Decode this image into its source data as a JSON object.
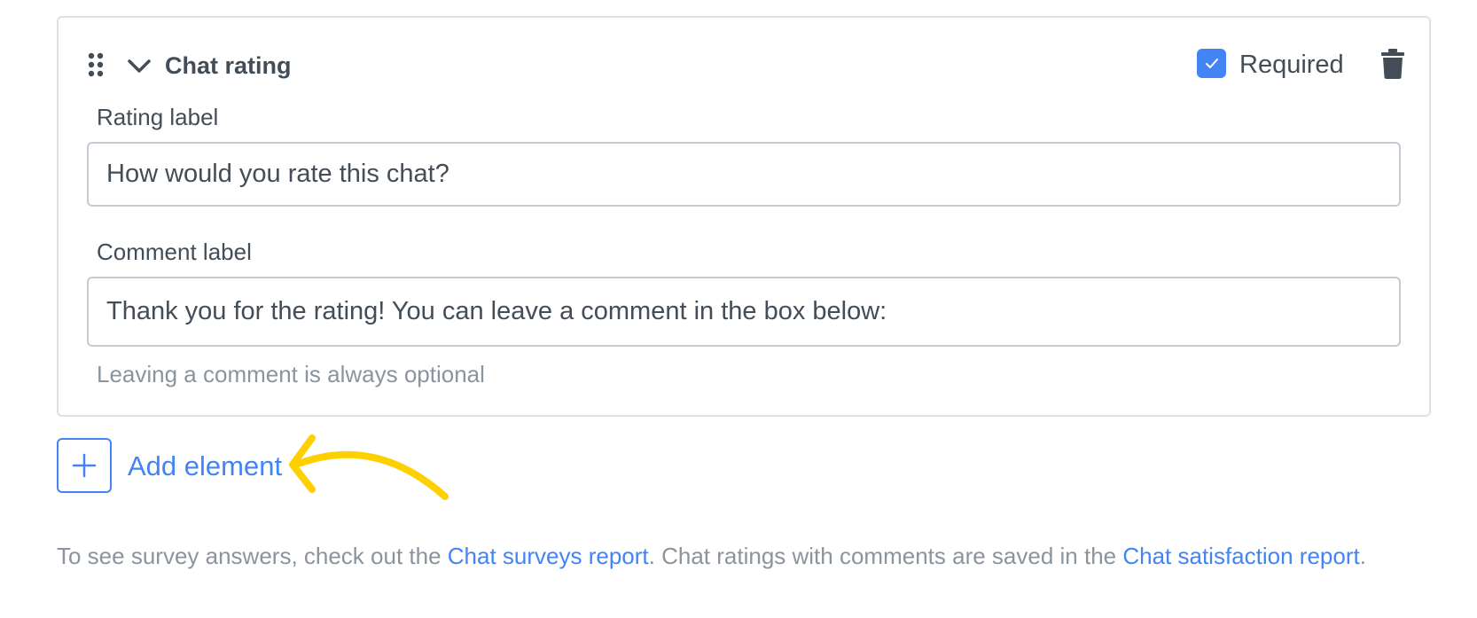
{
  "card": {
    "title": "Chat rating",
    "required_label": "Required",
    "required_checked": true,
    "rating_field": {
      "label": "Rating label",
      "value": "How would you rate this chat?"
    },
    "comment_field": {
      "label": "Comment label",
      "value": "Thank you for the rating! You can leave a comment in the box below:",
      "hint": "Leaving a comment is always optional"
    }
  },
  "add_element": {
    "label": "Add element",
    "icon": "plus-icon"
  },
  "footer": {
    "text_1": "To see survey answers, check out the ",
    "link_1": "Chat surveys report",
    "text_2": ". Chat ratings with comments are saved in the ",
    "link_2": "Chat satisfaction report",
    "text_3": "."
  },
  "colors": {
    "accent": "#4384f5",
    "annotation_arrow": "#ffd000",
    "text": "#424d57",
    "muted": "#8a949e",
    "border": "#dde2e6"
  },
  "icons": [
    "drag-handle-icon",
    "chevron-down-icon",
    "checkmark-icon",
    "trash-icon",
    "plus-icon",
    "annotation-arrow"
  ]
}
